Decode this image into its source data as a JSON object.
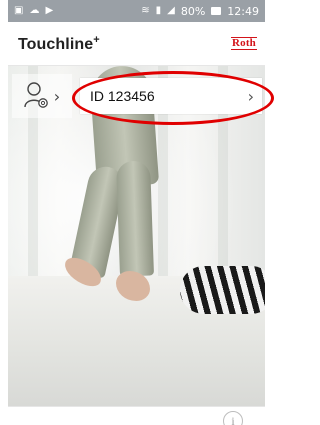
{
  "statusbar": {
    "time": "12:49",
    "battery": "80%",
    "icons": [
      "image-icon",
      "cloud-icon",
      "play-store-icon",
      "wifi-icon",
      "notification-icon",
      "signal-icon",
      "battery-icon"
    ]
  },
  "app": {
    "title": "Touchline",
    "title_sup": "+",
    "logo": "Roth",
    "brand_color": "#d3141a"
  },
  "account": {
    "id_text": "ID 123456"
  },
  "bottom": {
    "info_glyph": "i"
  },
  "colors": {
    "highlight": "#e00000",
    "statusbar": "#9aa0a6"
  }
}
